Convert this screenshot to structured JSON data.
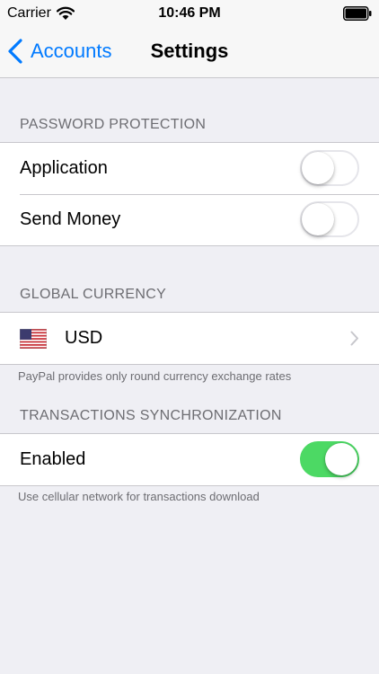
{
  "status_bar": {
    "carrier": "Carrier",
    "time": "10:46 PM"
  },
  "nav": {
    "back_label": "Accounts",
    "title": "Settings"
  },
  "sections": {
    "password": {
      "header": "PASSWORD PROTECTION",
      "rows": [
        {
          "label": "Application",
          "enabled": false
        },
        {
          "label": "Send Money",
          "enabled": false
        }
      ]
    },
    "currency": {
      "header": "GLOBAL CURRENCY",
      "value": "USD",
      "flag": "us-flag-icon",
      "footer": "PayPal provides only round currency exchange rates"
    },
    "sync": {
      "header": "TRANSACTIONS SYNCHRONIZATION",
      "rows": [
        {
          "label": "Enabled",
          "enabled": true
        }
      ],
      "footer": "Use cellular network for transactions download"
    }
  },
  "colors": {
    "accent": "#007aff",
    "toggle_on": "#4cd964",
    "background": "#efeff4"
  }
}
